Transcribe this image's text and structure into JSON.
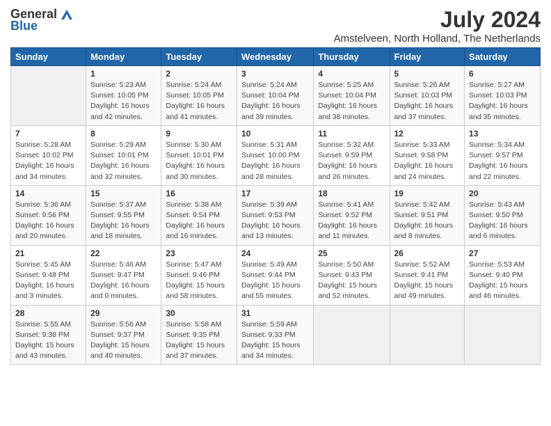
{
  "header": {
    "logo_general": "General",
    "logo_blue": "Blue",
    "title": "July 2024",
    "subtitle": "Amstelveen, North Holland, The Netherlands"
  },
  "days_of_week": [
    "Sunday",
    "Monday",
    "Tuesday",
    "Wednesday",
    "Thursday",
    "Friday",
    "Saturday"
  ],
  "weeks": [
    [
      {
        "day": "",
        "info": ""
      },
      {
        "day": "1",
        "info": "Sunrise: 5:23 AM\nSunset: 10:05 PM\nDaylight: 16 hours\nand 42 minutes."
      },
      {
        "day": "2",
        "info": "Sunrise: 5:24 AM\nSunset: 10:05 PM\nDaylight: 16 hours\nand 41 minutes."
      },
      {
        "day": "3",
        "info": "Sunrise: 5:24 AM\nSunset: 10:04 PM\nDaylight: 16 hours\nand 39 minutes."
      },
      {
        "day": "4",
        "info": "Sunrise: 5:25 AM\nSunset: 10:04 PM\nDaylight: 16 hours\nand 38 minutes."
      },
      {
        "day": "5",
        "info": "Sunrise: 5:26 AM\nSunset: 10:03 PM\nDaylight: 16 hours\nand 37 minutes."
      },
      {
        "day": "6",
        "info": "Sunrise: 5:27 AM\nSunset: 10:03 PM\nDaylight: 16 hours\nand 35 minutes."
      }
    ],
    [
      {
        "day": "7",
        "info": "Sunrise: 5:28 AM\nSunset: 10:02 PM\nDaylight: 16 hours\nand 34 minutes."
      },
      {
        "day": "8",
        "info": "Sunrise: 5:29 AM\nSunset: 10:01 PM\nDaylight: 16 hours\nand 32 minutes."
      },
      {
        "day": "9",
        "info": "Sunrise: 5:30 AM\nSunset: 10:01 PM\nDaylight: 16 hours\nand 30 minutes."
      },
      {
        "day": "10",
        "info": "Sunrise: 5:31 AM\nSunset: 10:00 PM\nDaylight: 16 hours\nand 28 minutes."
      },
      {
        "day": "11",
        "info": "Sunrise: 5:32 AM\nSunset: 9:59 PM\nDaylight: 16 hours\nand 26 minutes."
      },
      {
        "day": "12",
        "info": "Sunrise: 5:33 AM\nSunset: 9:58 PM\nDaylight: 16 hours\nand 24 minutes."
      },
      {
        "day": "13",
        "info": "Sunrise: 5:34 AM\nSunset: 9:57 PM\nDaylight: 16 hours\nand 22 minutes."
      }
    ],
    [
      {
        "day": "14",
        "info": "Sunrise: 5:36 AM\nSunset: 9:56 PM\nDaylight: 16 hours\nand 20 minutes."
      },
      {
        "day": "15",
        "info": "Sunrise: 5:37 AM\nSunset: 9:55 PM\nDaylight: 16 hours\nand 18 minutes."
      },
      {
        "day": "16",
        "info": "Sunrise: 5:38 AM\nSunset: 9:54 PM\nDaylight: 16 hours\nand 16 minutes."
      },
      {
        "day": "17",
        "info": "Sunrise: 5:39 AM\nSunset: 9:53 PM\nDaylight: 16 hours\nand 13 minutes."
      },
      {
        "day": "18",
        "info": "Sunrise: 5:41 AM\nSunset: 9:52 PM\nDaylight: 16 hours\nand 11 minutes."
      },
      {
        "day": "19",
        "info": "Sunrise: 5:42 AM\nSunset: 9:51 PM\nDaylight: 16 hours\nand 8 minutes."
      },
      {
        "day": "20",
        "info": "Sunrise: 5:43 AM\nSunset: 9:50 PM\nDaylight: 16 hours\nand 6 minutes."
      }
    ],
    [
      {
        "day": "21",
        "info": "Sunrise: 5:45 AM\nSunset: 9:48 PM\nDaylight: 16 hours\nand 3 minutes."
      },
      {
        "day": "22",
        "info": "Sunrise: 5:46 AM\nSunset: 9:47 PM\nDaylight: 16 hours\nand 0 minutes."
      },
      {
        "day": "23",
        "info": "Sunrise: 5:47 AM\nSunset: 9:46 PM\nDaylight: 15 hours\nand 58 minutes."
      },
      {
        "day": "24",
        "info": "Sunrise: 5:49 AM\nSunset: 9:44 PM\nDaylight: 15 hours\nand 55 minutes."
      },
      {
        "day": "25",
        "info": "Sunrise: 5:50 AM\nSunset: 9:43 PM\nDaylight: 15 hours\nand 52 minutes."
      },
      {
        "day": "26",
        "info": "Sunrise: 5:52 AM\nSunset: 9:41 PM\nDaylight: 15 hours\nand 49 minutes."
      },
      {
        "day": "27",
        "info": "Sunrise: 5:53 AM\nSunset: 9:40 PM\nDaylight: 15 hours\nand 46 minutes."
      }
    ],
    [
      {
        "day": "28",
        "info": "Sunrise: 5:55 AM\nSunset: 9:38 PM\nDaylight: 15 hours\nand 43 minutes."
      },
      {
        "day": "29",
        "info": "Sunrise: 5:56 AM\nSunset: 9:37 PM\nDaylight: 15 hours\nand 40 minutes."
      },
      {
        "day": "30",
        "info": "Sunrise: 5:58 AM\nSunset: 9:35 PM\nDaylight: 15 hours\nand 37 minutes."
      },
      {
        "day": "31",
        "info": "Sunrise: 5:59 AM\nSunset: 9:33 PM\nDaylight: 15 hours\nand 34 minutes."
      },
      {
        "day": "",
        "info": ""
      },
      {
        "day": "",
        "info": ""
      },
      {
        "day": "",
        "info": ""
      }
    ]
  ]
}
